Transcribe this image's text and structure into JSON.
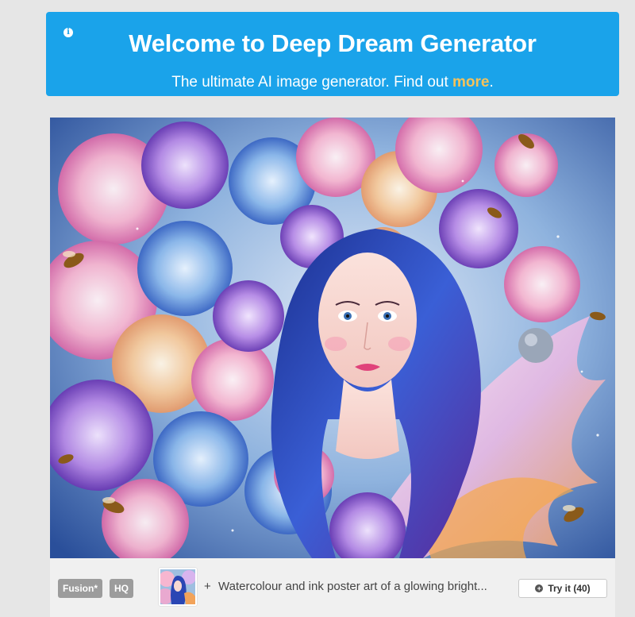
{
  "banner": {
    "info_icon": "info-icon",
    "title": "Welcome to Deep Dream Generator",
    "subtitle_prefix": "The ultimate AI image generator. Find out ",
    "more_link": "more",
    "subtitle_suffix": "."
  },
  "card": {
    "image_icon": "artwork-image",
    "badges": [
      "Fusion*",
      "HQ"
    ],
    "plus_sign": "+",
    "prompt": "Watercolour and ink poster art of a glowing bright...",
    "try_button": {
      "icon": "plus-circle-icon",
      "label": "Try it (40)"
    }
  },
  "colors": {
    "banner_bg": "#1aa3ea",
    "link": "#f6c25a",
    "badge_bg": "#9c9c9c",
    "page_bg": "#e6e6e6"
  }
}
